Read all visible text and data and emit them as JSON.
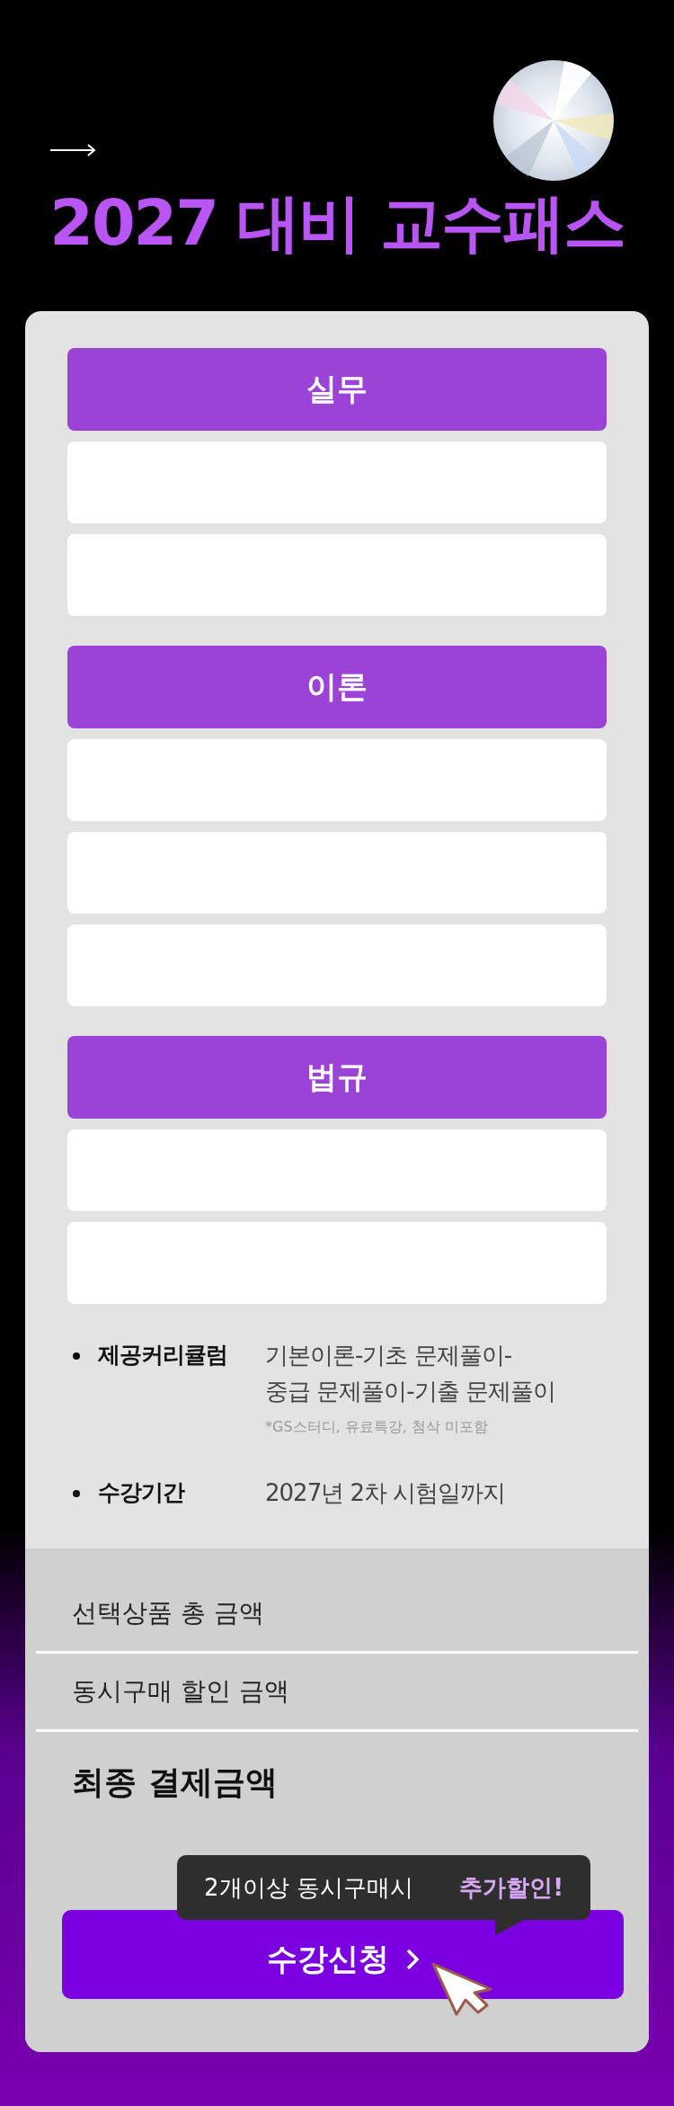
{
  "title": "2027 대비 교수패스",
  "sections": [
    {
      "title": "실무",
      "rows": [
        {
          "kind": "empty"
        },
        {
          "kind": "empty"
        }
      ]
    },
    {
      "title": "이론",
      "rows": [
        {
          "kind": "empty"
        },
        {
          "kind": "empty"
        },
        {
          "kind": "empty"
        }
      ]
    },
    {
      "title": "법규",
      "rows": [
        {
          "kind": "empty"
        },
        {
          "kind": "empty"
        }
      ]
    }
  ],
  "info": [
    {
      "label": "제공커리큘럼",
      "lines": [
        "기본이론-기초 문제풀이-",
        "중급 문제풀이-기출 문제풀이"
      ],
      "note": "*GS스터디, 유료특강, 첨삭 미포함"
    },
    {
      "label": "수강기간",
      "lines": [
        "2027년 2차 시험일까지"
      ]
    }
  ],
  "prices": [
    {
      "label": "선택상품 총 금액",
      "kind": "normal"
    },
    {
      "label": "동시구매 할인 금액",
      "kind": "normal"
    },
    {
      "label": "최종 결제금액",
      "kind": "total"
    }
  ],
  "tooltip": {
    "text": "2개이상 동시구매시",
    "highlight": "추가할인!"
  },
  "button": {
    "label": "수강신청"
  }
}
